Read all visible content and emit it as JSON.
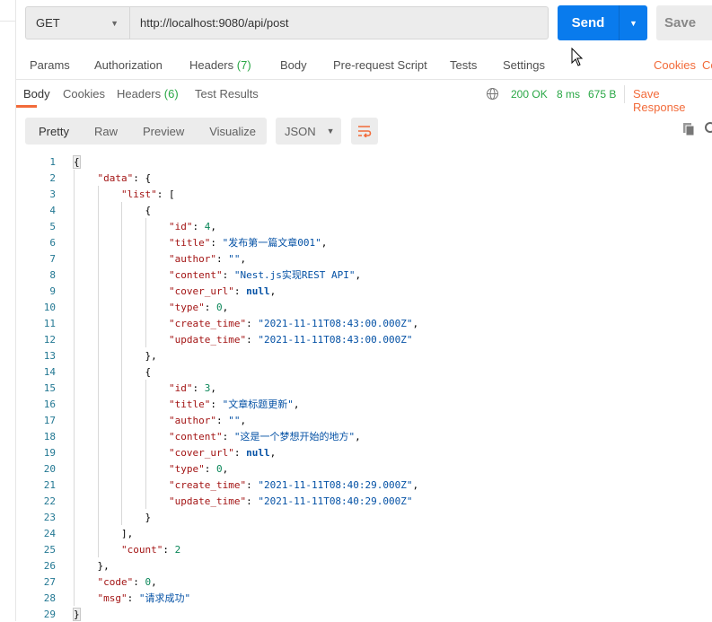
{
  "request": {
    "method": "GET",
    "url": "http://localhost:9080/api/post",
    "send_label": "Send",
    "save_label": "Save"
  },
  "request_tabs": [
    {
      "label": "Params"
    },
    {
      "label": "Authorization"
    },
    {
      "label": "Headers",
      "count": "(7)"
    },
    {
      "label": "Body"
    },
    {
      "label": "Pre-request Script"
    },
    {
      "label": "Tests"
    },
    {
      "label": "Settings"
    }
  ],
  "request_links": {
    "cookies": "Cookies",
    "code": "Co"
  },
  "response_tabs": [
    {
      "label": "Body"
    },
    {
      "label": "Cookies"
    },
    {
      "label": "Headers",
      "count": "(6)"
    },
    {
      "label": "Test Results"
    }
  ],
  "status": {
    "code": "200 OK",
    "time": "8 ms",
    "size": "675 B",
    "save_response": "Save Response"
  },
  "view": {
    "modes": [
      "Pretty",
      "Raw",
      "Preview",
      "Visualize"
    ],
    "format": "JSON"
  },
  "colors": {
    "accent": "#f26b3a",
    "send": "#097bed",
    "ok": "#29a745"
  },
  "code_lines": [
    {
      "i": 0,
      "t": [
        [
          "p",
          "{"
        ]
      ]
    },
    {
      "i": 1,
      "t": [
        [
          "k",
          "\"data\""
        ],
        [
          "p",
          ": {"
        ]
      ]
    },
    {
      "i": 2,
      "t": [
        [
          "k",
          "\"list\""
        ],
        [
          "p",
          ": ["
        ]
      ]
    },
    {
      "i": 3,
      "t": [
        [
          "p",
          "{"
        ]
      ]
    },
    {
      "i": 4,
      "t": [
        [
          "k",
          "\"id\""
        ],
        [
          "p",
          ": "
        ],
        [
          "n",
          "4"
        ],
        [
          "p",
          ","
        ]
      ]
    },
    {
      "i": 4,
      "t": [
        [
          "k",
          "\"title\""
        ],
        [
          "p",
          ": "
        ],
        [
          "s",
          "\"发布第一篇文章001\""
        ],
        [
          "p",
          ","
        ]
      ]
    },
    {
      "i": 4,
      "t": [
        [
          "k",
          "\"author\""
        ],
        [
          "p",
          ": "
        ],
        [
          "s",
          "\"\""
        ],
        [
          "p",
          ","
        ]
      ]
    },
    {
      "i": 4,
      "t": [
        [
          "k",
          "\"content\""
        ],
        [
          "p",
          ": "
        ],
        [
          "s",
          "\"Nest.js实现REST API\""
        ],
        [
          "p",
          ","
        ]
      ]
    },
    {
      "i": 4,
      "t": [
        [
          "k",
          "\"cover_url\""
        ],
        [
          "p",
          ": "
        ],
        [
          "b",
          "null"
        ],
        [
          "p",
          ","
        ]
      ]
    },
    {
      "i": 4,
      "t": [
        [
          "k",
          "\"type\""
        ],
        [
          "p",
          ": "
        ],
        [
          "n",
          "0"
        ],
        [
          "p",
          ","
        ]
      ]
    },
    {
      "i": 4,
      "t": [
        [
          "k",
          "\"create_time\""
        ],
        [
          "p",
          ": "
        ],
        [
          "s",
          "\"2021-11-11T08:43:00.000Z\""
        ],
        [
          "p",
          ","
        ]
      ]
    },
    {
      "i": 4,
      "t": [
        [
          "k",
          "\"update_time\""
        ],
        [
          "p",
          ": "
        ],
        [
          "s",
          "\"2021-11-11T08:43:00.000Z\""
        ]
      ]
    },
    {
      "i": 3,
      "t": [
        [
          "p",
          "},"
        ]
      ]
    },
    {
      "i": 3,
      "t": [
        [
          "p",
          "{"
        ]
      ]
    },
    {
      "i": 4,
      "t": [
        [
          "k",
          "\"id\""
        ],
        [
          "p",
          ": "
        ],
        [
          "n",
          "3"
        ],
        [
          "p",
          ","
        ]
      ]
    },
    {
      "i": 4,
      "t": [
        [
          "k",
          "\"title\""
        ],
        [
          "p",
          ": "
        ],
        [
          "s",
          "\"文章标题更新\""
        ],
        [
          "p",
          ","
        ]
      ]
    },
    {
      "i": 4,
      "t": [
        [
          "k",
          "\"author\""
        ],
        [
          "p",
          ": "
        ],
        [
          "s",
          "\"\""
        ],
        [
          "p",
          ","
        ]
      ]
    },
    {
      "i": 4,
      "t": [
        [
          "k",
          "\"content\""
        ],
        [
          "p",
          ": "
        ],
        [
          "s",
          "\"这是一个梦想开始的地方\""
        ],
        [
          "p",
          ","
        ]
      ]
    },
    {
      "i": 4,
      "t": [
        [
          "k",
          "\"cover_url\""
        ],
        [
          "p",
          ": "
        ],
        [
          "b",
          "null"
        ],
        [
          "p",
          ","
        ]
      ]
    },
    {
      "i": 4,
      "t": [
        [
          "k",
          "\"type\""
        ],
        [
          "p",
          ": "
        ],
        [
          "n",
          "0"
        ],
        [
          "p",
          ","
        ]
      ]
    },
    {
      "i": 4,
      "t": [
        [
          "k",
          "\"create_time\""
        ],
        [
          "p",
          ": "
        ],
        [
          "s",
          "\"2021-11-11T08:40:29.000Z\""
        ],
        [
          "p",
          ","
        ]
      ]
    },
    {
      "i": 4,
      "t": [
        [
          "k",
          "\"update_time\""
        ],
        [
          "p",
          ": "
        ],
        [
          "s",
          "\"2021-11-11T08:40:29.000Z\""
        ]
      ]
    },
    {
      "i": 3,
      "t": [
        [
          "p",
          "}"
        ]
      ]
    },
    {
      "i": 2,
      "t": [
        [
          "p",
          "],"
        ]
      ]
    },
    {
      "i": 2,
      "t": [
        [
          "k",
          "\"count\""
        ],
        [
          "p",
          ": "
        ],
        [
          "n",
          "2"
        ]
      ]
    },
    {
      "i": 1,
      "t": [
        [
          "p",
          "},"
        ]
      ]
    },
    {
      "i": 1,
      "t": [
        [
          "k",
          "\"code\""
        ],
        [
          "p",
          ": "
        ],
        [
          "n",
          "0"
        ],
        [
          "p",
          ","
        ]
      ]
    },
    {
      "i": 1,
      "t": [
        [
          "k",
          "\"msg\""
        ],
        [
          "p",
          ": "
        ],
        [
          "s",
          "\"请求成功\""
        ]
      ]
    },
    {
      "i": 0,
      "t": [
        [
          "p",
          "}"
        ]
      ]
    }
  ]
}
